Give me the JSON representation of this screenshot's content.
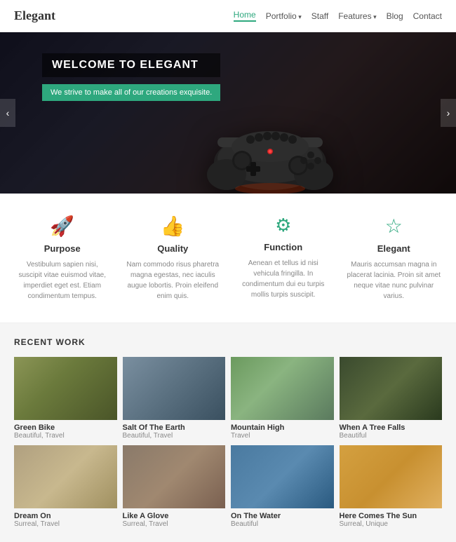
{
  "header": {
    "logo": "Elegant",
    "nav": [
      {
        "label": "Home",
        "active": true,
        "hasArrow": false
      },
      {
        "label": "Portfolio",
        "active": false,
        "hasArrow": true
      },
      {
        "label": "Staff",
        "active": false,
        "hasArrow": false
      },
      {
        "label": "Features",
        "active": false,
        "hasArrow": true
      },
      {
        "label": "Blog",
        "active": false,
        "hasArrow": false
      },
      {
        "label": "Contact",
        "active": false,
        "hasArrow": false
      }
    ]
  },
  "hero": {
    "title": "WELCOME TO ELEGANT",
    "subtitle": "We strive to make all of our creations exquisite.",
    "prevArrow": "‹",
    "nextArrow": "›"
  },
  "features": [
    {
      "icon": "🚀",
      "title": "Purpose",
      "desc": "Vestibulum sapien nisi, suscipit vitae euismod vitae, imperdiet eget est. Etiam condimentum tempus."
    },
    {
      "icon": "👍",
      "title": "Quality",
      "desc": "Nam commodo risus pharetra magna egestas, nec iaculis augue lobortis. Proin eleifend enim quis."
    },
    {
      "icon": "⚙",
      "title": "Function",
      "desc": "Aenean et tellus id nisi vehicula fringilla. In condimentum dui eu turpis mollis turpis suscipit."
    },
    {
      "icon": "☆",
      "title": "Elegant",
      "desc": "Mauris accumsan magna in placerat lacinia. Proin sit amet neque vitae nunc pulvinar varius."
    }
  ],
  "recentWork": {
    "sectionTitle": "RECENT WORK",
    "items": [
      {
        "title": "Green Bike",
        "tags": "Beautiful, Travel",
        "colorClass": "img-green-bike"
      },
      {
        "title": "Salt Of The Earth",
        "tags": "Beautiful, Travel",
        "colorClass": "img-salt"
      },
      {
        "title": "Mountain High",
        "tags": "Travel",
        "colorClass": "img-mountain"
      },
      {
        "title": "When A Tree Falls",
        "tags": "Beautiful",
        "colorClass": "img-tree"
      },
      {
        "title": "Dream On",
        "tags": "Surreal, Travel",
        "colorClass": "img-dream"
      },
      {
        "title": "Like A Glove",
        "tags": "Surreal, Travel",
        "colorClass": "img-glove"
      },
      {
        "title": "On The Water",
        "tags": "Beautiful",
        "colorClass": "img-water"
      },
      {
        "title": "Here Comes The Sun",
        "tags": "Surreal, Unique",
        "colorClass": "img-sun"
      }
    ]
  }
}
